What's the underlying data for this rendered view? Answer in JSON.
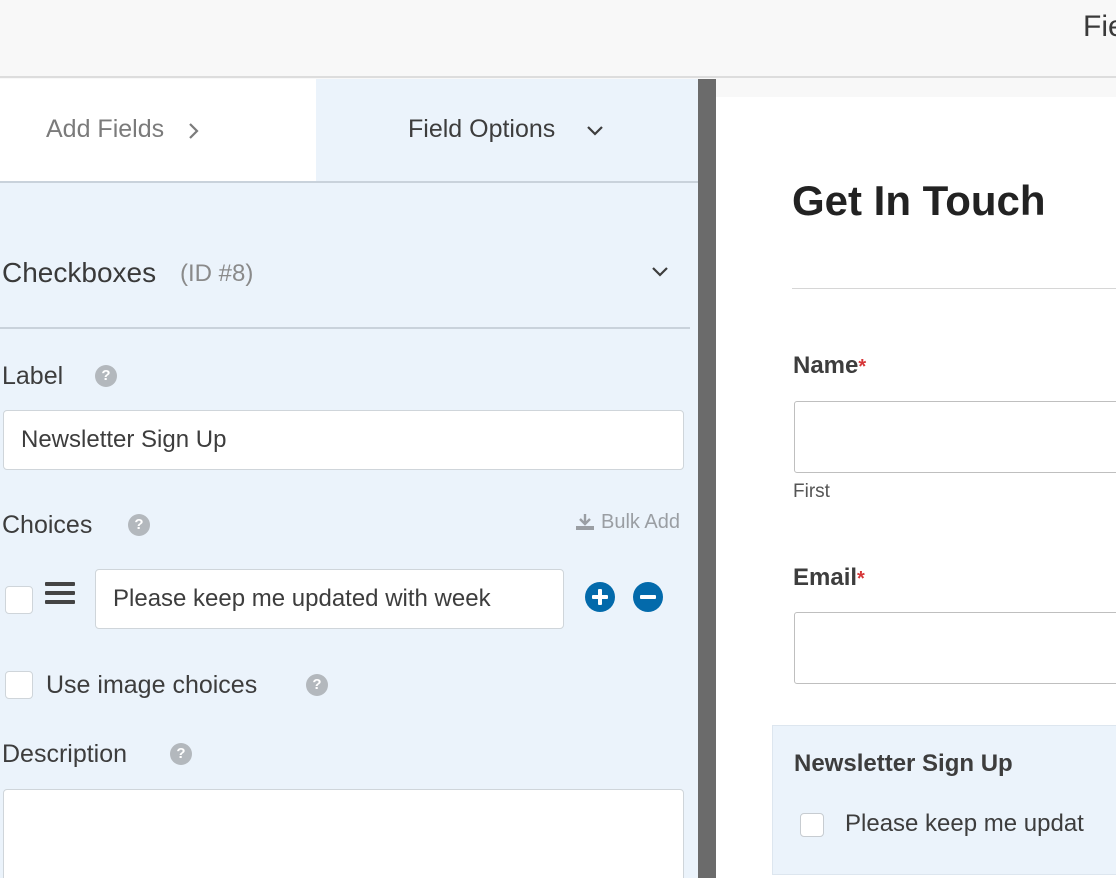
{
  "topbar": {
    "title": "Fie"
  },
  "tabs": {
    "add_fields": "Add Fields",
    "field_options": "Field Options"
  },
  "section": {
    "title": "Checkboxes",
    "id_label": "(ID #8)"
  },
  "label_field": {
    "label": "Label",
    "value": "Newsletter Sign Up"
  },
  "choices": {
    "label": "Choices",
    "bulk_add": "Bulk Add",
    "items": [
      {
        "value": "Please keep me updated with week",
        "checked": false
      }
    ]
  },
  "image_choices": {
    "label": "Use image choices",
    "checked": false
  },
  "description": {
    "label": "Description",
    "value": ""
  },
  "help_glyph": "?",
  "colors": {
    "accent": "#036aab",
    "panel": "#ebf3fb",
    "required": "#d63638"
  },
  "preview": {
    "title": "Get In Touch",
    "name": {
      "label": "Name",
      "required_mark": "*",
      "sublabel": "First"
    },
    "email": {
      "label": "Email",
      "required_mark": "*"
    },
    "newsletter": {
      "label": "Newsletter Sign Up",
      "choice": "Please keep me updat"
    }
  }
}
